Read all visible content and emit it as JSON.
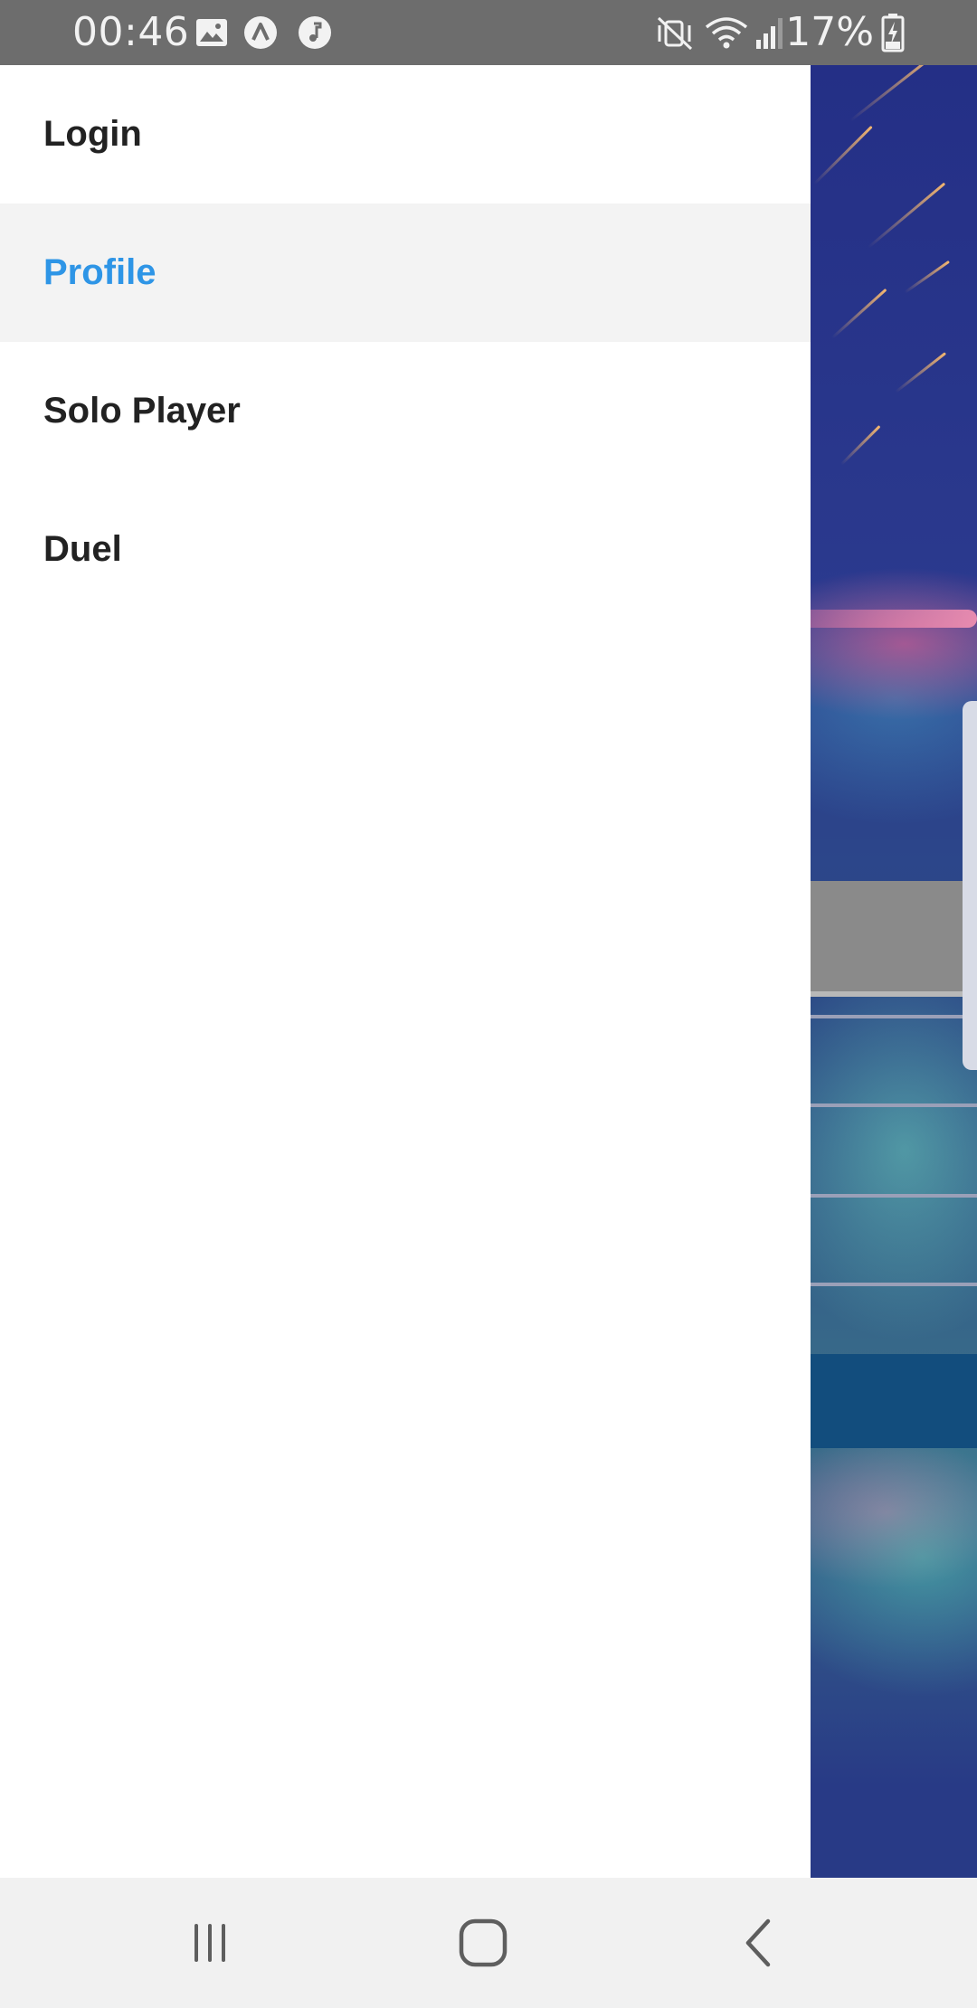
{
  "status_bar": {
    "time": "00:46",
    "battery_percent": "17%",
    "left_icons": [
      "gallery-icon",
      "app-notification-icon",
      "music-icon"
    ],
    "right_icons": [
      "mute-vibrate-icon",
      "wifi-icon",
      "cellular-signal-icon",
      "battery-charging-icon"
    ]
  },
  "drawer": {
    "items": [
      {
        "label": "Login",
        "active": false
      },
      {
        "label": "Profile",
        "active": true
      },
      {
        "label": "Solo Player",
        "active": false
      },
      {
        "label": "Duel",
        "active": false
      }
    ]
  },
  "nav_bar": {
    "buttons": [
      "recent-apps-icon",
      "home-icon",
      "back-icon"
    ]
  },
  "colors": {
    "status_bar_bg": "#6d6d6d",
    "drawer_bg": "#ffffff",
    "active_item_bg": "#f3f3f3",
    "active_item_text": "#2e95e6",
    "item_text": "#222222",
    "nav_bar_bg": "#f1f1f1"
  }
}
